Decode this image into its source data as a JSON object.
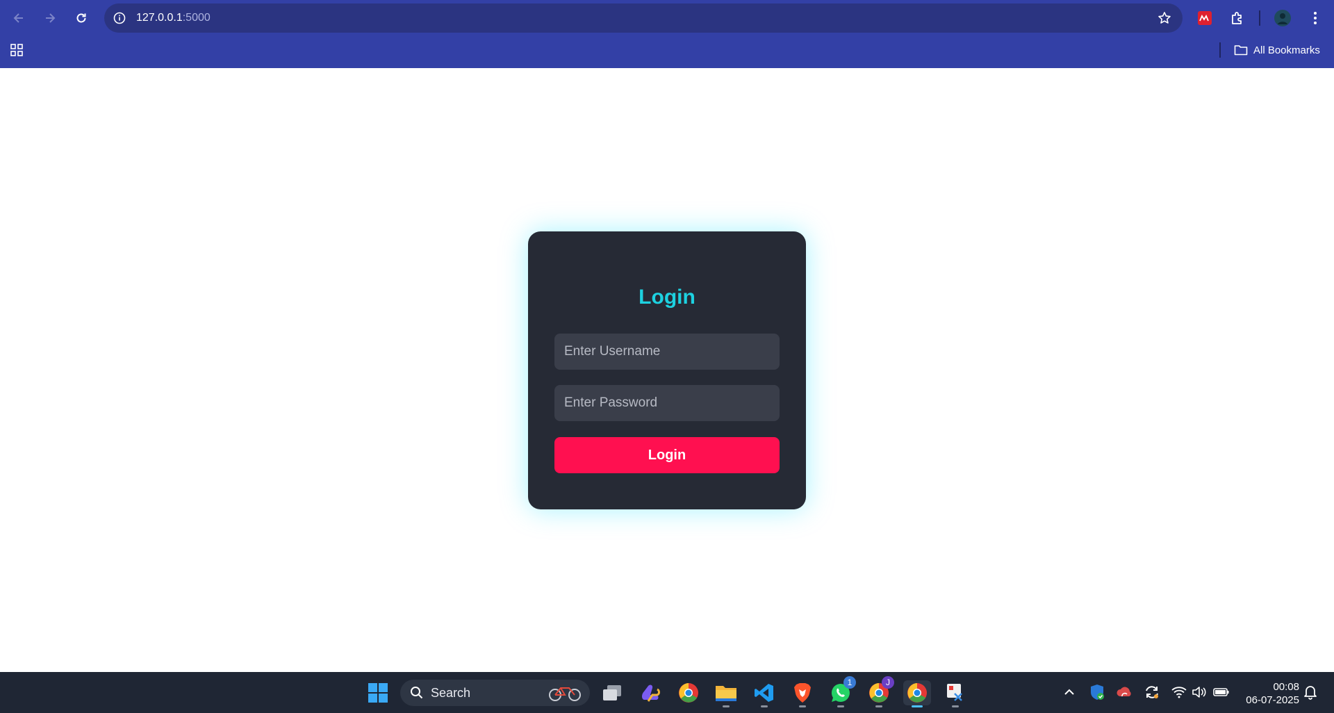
{
  "browser": {
    "url_host": "127.0.0.1",
    "url_port": ":5000",
    "bookmarks_label": "All Bookmarks"
  },
  "login": {
    "title": "Login",
    "username_placeholder": "Enter Username",
    "password_placeholder": "Enter Password",
    "button_label": "Login",
    "accent_color": "#1dd1e0",
    "button_color": "#ff1050",
    "card_color": "#262a35"
  },
  "taskbar": {
    "search_label": "Search",
    "whatsapp_badge": "1",
    "chrome_profile_badge": "J",
    "time": "00:08",
    "date": "06-07-2025"
  },
  "icons": {
    "back": "arrow-left-icon",
    "forward": "arrow-right-icon",
    "reload": "reload-icon",
    "site_info": "info-icon",
    "bookmark_star": "star-icon",
    "extension_red": "extension-icon",
    "extensions": "puzzle-icon",
    "profile": "avatar-icon",
    "menu": "kebab-menu-icon",
    "apps": "apps-grid-icon",
    "folder": "folder-icon"
  }
}
